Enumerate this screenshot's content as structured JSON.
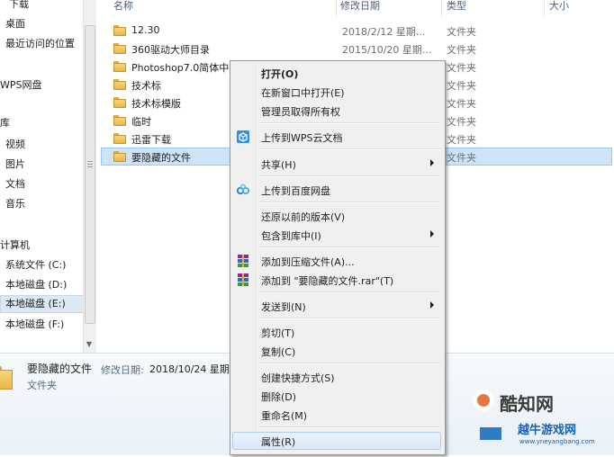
{
  "nav": {
    "items": [
      {
        "label": "下载"
      },
      {
        "label": "桌面"
      },
      {
        "label": "最近访问的位置"
      },
      {
        "label": "WPS网盘"
      },
      {
        "label": "库"
      },
      {
        "label": "视频"
      },
      {
        "label": "图片"
      },
      {
        "label": "文档"
      },
      {
        "label": "音乐"
      },
      {
        "label": "计算机"
      },
      {
        "label": "系统文件 (C:)"
      },
      {
        "label": "本地磁盘 (D:)"
      },
      {
        "label": "本地磁盘 (E:)"
      },
      {
        "label": "本地磁盘 (F:)"
      }
    ],
    "selected": "本地磁盘 (E:)"
  },
  "list": {
    "headers": {
      "name": "名称",
      "date": "修改日期",
      "type": "类型",
      "size": "大小"
    },
    "rows": [
      {
        "name": "12.30",
        "date": "2018/2/12 星期...",
        "type": "文件夹"
      },
      {
        "name": "360驱动大师目录",
        "date": "2015/10/20 星期...",
        "type": "文件夹"
      },
      {
        "name": "Photoshop7.0简体中...",
        "date": "",
        "type": "文件夹"
      },
      {
        "name": "技术标",
        "date": "",
        "type": "文件夹"
      },
      {
        "name": "技术标模版",
        "date": "",
        "type": "文件夹"
      },
      {
        "name": "临时",
        "date": "",
        "type": "文件夹"
      },
      {
        "name": "迅雷下载",
        "date": "",
        "type": "文件夹"
      },
      {
        "name": "要隐藏的文件",
        "date": "",
        "type": "文件夹"
      }
    ],
    "selected_index": 7
  },
  "details": {
    "name": "要隐藏的文件",
    "date_label": "修改日期:",
    "date_value": "2018/10/24 星期...",
    "type": "文件夹"
  },
  "context_menu": {
    "items": [
      {
        "label": "打开(O)",
        "bold": true,
        "icon": ""
      },
      {
        "label": "在新窗口中打开(E)",
        "icon": ""
      },
      {
        "label": "管理员取得所有权",
        "icon": ""
      },
      {
        "sep": true
      },
      {
        "label": "上传到WPS云文档",
        "icon": "wps-cloud-icon"
      },
      {
        "sep": true
      },
      {
        "label": "共享(H)",
        "submenu": true,
        "icon": ""
      },
      {
        "sep": true
      },
      {
        "label": "上传到百度网盘",
        "icon": "baidu-netdisk-icon"
      },
      {
        "sep": true
      },
      {
        "label": "还原以前的版本(V)",
        "icon": ""
      },
      {
        "label": "包含到库中(I)",
        "submenu": true,
        "icon": ""
      },
      {
        "sep": true
      },
      {
        "label": "添加到压缩文件(A)...",
        "icon": "winrar-icon"
      },
      {
        "label": "添加到 \"要隐藏的文件.rar\"(T)",
        "icon": "winrar-icon"
      },
      {
        "sep": true
      },
      {
        "label": "发送到(N)",
        "submenu": true,
        "icon": ""
      },
      {
        "sep": true
      },
      {
        "label": "剪切(T)",
        "icon": ""
      },
      {
        "label": "复制(C)",
        "icon": ""
      },
      {
        "sep": true
      },
      {
        "label": "创建快捷方式(S)",
        "icon": ""
      },
      {
        "label": "删除(D)",
        "icon": ""
      },
      {
        "label": "重命名(M)",
        "icon": ""
      },
      {
        "sep": true
      },
      {
        "label": "属性(R)",
        "icon": "",
        "highlighted": true
      }
    ]
  },
  "watermark": {
    "brand": "酷知网",
    "sub": "越牛游戏网",
    "url": "www.yneyangbang.com"
  },
  "colors": {
    "selection_bg": "#cde3f8",
    "menu_bg": "#f0f0f0",
    "folder_yellow": "#f6d67a",
    "header_text": "#4c607a"
  }
}
